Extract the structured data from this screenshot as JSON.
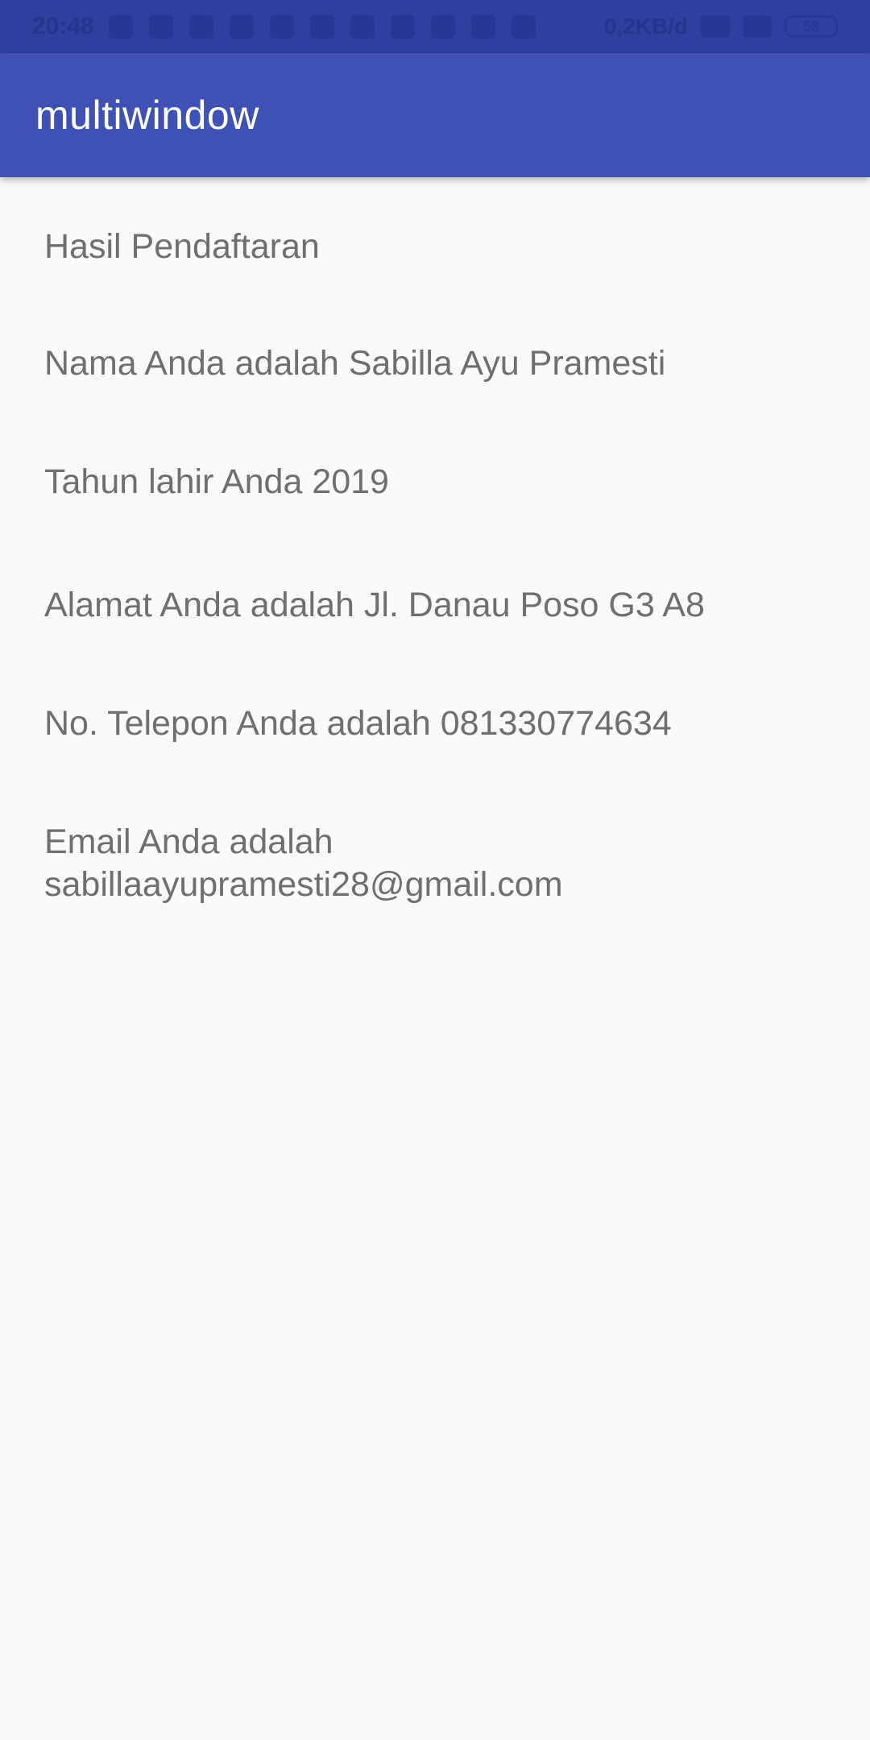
{
  "status_bar": {
    "time": "20:48",
    "net_speed": "0,2KB/d",
    "battery": "58"
  },
  "app_bar": {
    "title": "multiwindow"
  },
  "results": {
    "heading": "Hasil Pendaftaran",
    "name": "Nama Anda adalah Sabilla Ayu Pramesti",
    "birth_year": "Tahun lahir Anda 2019",
    "address": "Alamat Anda adalah Jl. Danau Poso G3 A8",
    "phone": "No. Telepon Anda adalah 081330774634",
    "email_line1": "Email Anda adalah",
    "email_line2": "sabillaayupramesti28@gmail.com"
  },
  "colors": {
    "status_bar": "#2f3f9f",
    "app_bar": "#3f51b5",
    "background": "#fafafa",
    "text": "#6f6f6f"
  }
}
